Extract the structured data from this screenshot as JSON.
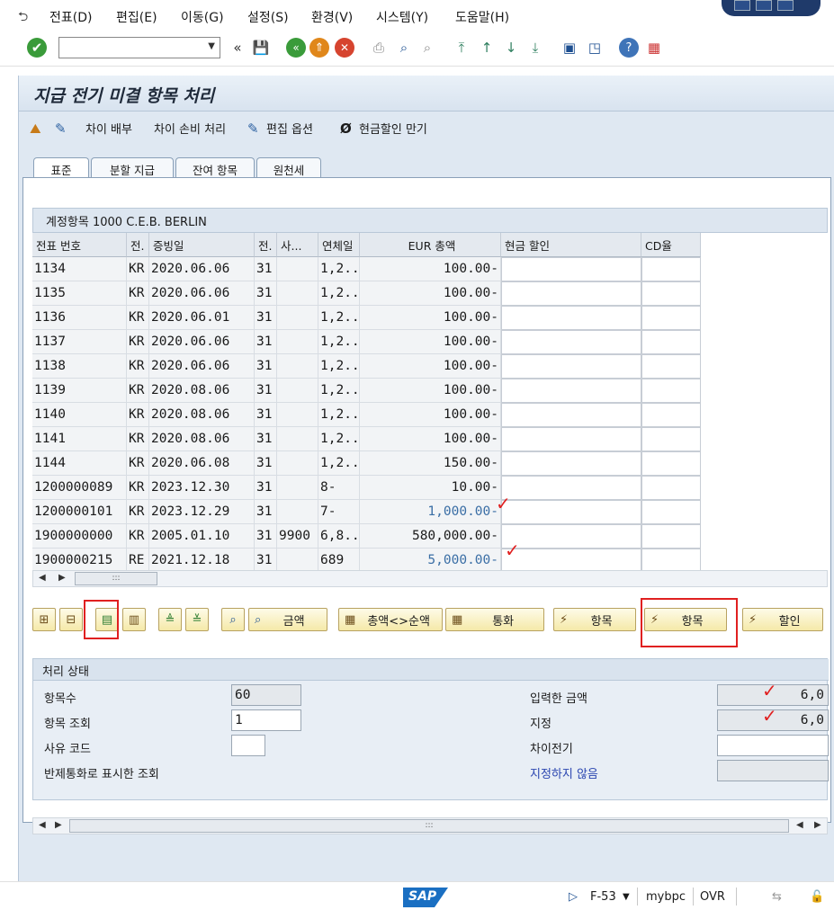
{
  "menu": {
    "items": [
      "전표(D)",
      "편집(E)",
      "이동(G)",
      "설정(S)",
      "환경(V)",
      "시스템(Y)",
      "도움말(H)"
    ]
  },
  "toolbar": {
    "command_value": "",
    "icons": [
      "enter-icon",
      "back-icon",
      "exit-icon",
      "cancel-icon",
      "print-icon",
      "find-icon",
      "find-next-icon",
      "first-page-icon",
      "prev-page-icon",
      "next-page-icon",
      "last-page-icon",
      "new-session-icon",
      "shortcut-icon",
      "help-icon",
      "layout-icon"
    ]
  },
  "title": "지급 전기 미결 항목 처리",
  "appbar": {
    "buttons": [
      "차이 배부",
      "차이 손비 처리",
      "편집 옵션",
      "현금할인 만기"
    ]
  },
  "tabs": [
    "표준",
    "분할 지급",
    "잔여 항목",
    "원천세"
  ],
  "table": {
    "caption": "계정항목 1000 C.E.B. BERLIN",
    "columns": [
      "전표 번호",
      "전.",
      "증빙일",
      "전.",
      "사...",
      "연체일",
      "EUR 총액",
      "현금 할인",
      "CD율"
    ],
    "rows": [
      [
        "1134",
        "KR",
        "2020.06.06",
        "31",
        "",
        "1,2...",
        "100.00-",
        "",
        ""
      ],
      [
        "1135",
        "KR",
        "2020.06.06",
        "31",
        "",
        "1,2...",
        "100.00-",
        "",
        ""
      ],
      [
        "1136",
        "KR",
        "2020.06.01",
        "31",
        "",
        "1,2...",
        "100.00-",
        "",
        ""
      ],
      [
        "1137",
        "KR",
        "2020.06.06",
        "31",
        "",
        "1,2...",
        "100.00-",
        "",
        ""
      ],
      [
        "1138",
        "KR",
        "2020.06.06",
        "31",
        "",
        "1,2...",
        "100.00-",
        "",
        ""
      ],
      [
        "1139",
        "KR",
        "2020.08.06",
        "31",
        "",
        "1,2...",
        "100.00-",
        "",
        ""
      ],
      [
        "1140",
        "KR",
        "2020.08.06",
        "31",
        "",
        "1,2...",
        "100.00-",
        "",
        ""
      ],
      [
        "1141",
        "KR",
        "2020.08.06",
        "31",
        "",
        "1,2...",
        "100.00-",
        "",
        ""
      ],
      [
        "1144",
        "KR",
        "2020.06.08",
        "31",
        "",
        "1,2...",
        "150.00-",
        "",
        ""
      ],
      [
        "1200000089",
        "KR",
        "2023.12.30",
        "31",
        "",
        "8-",
        "10.00-",
        "",
        ""
      ],
      [
        "1200000101",
        "KR",
        "2023.12.29",
        "31",
        "",
        "7-",
        "1,000.00-",
        "",
        ""
      ],
      [
        "1900000000",
        "KR",
        "2005.01.10",
        "31",
        "9900",
        "6,8...",
        "580,000.00-",
        "",
        ""
      ],
      [
        "1900000215",
        "RE",
        "2021.12.18",
        "31",
        "",
        "689",
        "5,000.00-",
        "",
        ""
      ]
    ]
  },
  "function_buttons": {
    "amount": "금액",
    "gross_net": "총액<>순액",
    "currency": "통화",
    "items1": "항목",
    "items2": "항목",
    "discount": "할인"
  },
  "status": {
    "header": "처리 상태",
    "item_count_label": "항목수",
    "item_count_value": "60",
    "item_display_label": "항목 조회",
    "item_display_value": "1",
    "reason_code_label": "사유 코드",
    "reason_code_value": "",
    "clearing_currency_label": "반제통화로 표시한 조회",
    "entered_amount_label": "입력한 금액",
    "entered_amount_value": "6,0",
    "assigned_label": "지정",
    "assigned_value": "6,0",
    "difference_label": "차이전기",
    "difference_value": "",
    "not_assigned_label": "지정하지 않음",
    "not_assigned_value": ""
  },
  "footer": {
    "transaction": "F-53",
    "system": "mybpc",
    "mode": "OVR",
    "logo": "SAP"
  }
}
